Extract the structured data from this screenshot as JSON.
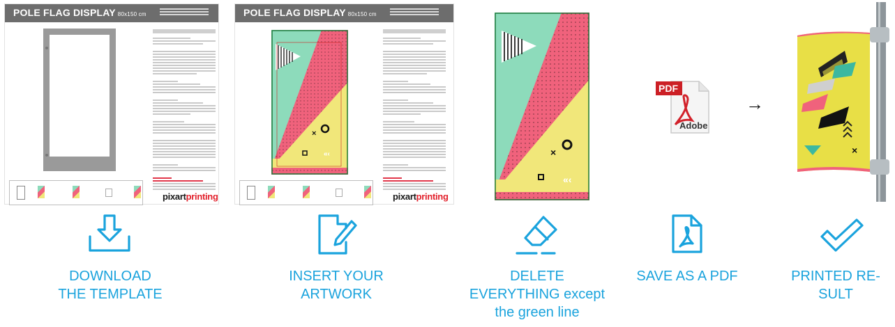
{
  "template_sheet": {
    "title": "POLE FLAG DISPLAY",
    "size": "80x150 cm",
    "brand_part1": "pixart",
    "brand_part2": "printing"
  },
  "pdf_icon": {
    "badge": "PDF",
    "vendor": "Adobe"
  },
  "arrow": "→",
  "steps": [
    {
      "icon": "download-tray-icon",
      "line1": "DOWNLOAD",
      "line2": "THE TEMPLATE"
    },
    {
      "icon": "edit-document-icon",
      "line1": "INSERT YOUR",
      "line2": "ARTWORK"
    },
    {
      "icon": "eraser-icon",
      "line1": "DELETE",
      "line2": "EVERYTHING except",
      "line3": "the green line"
    },
    {
      "icon": "pdf-document-icon",
      "line1": "SAVE AS A PDF"
    },
    {
      "icon": "checkmark-icon",
      "line1": "PRINTED RE-",
      "line2": "SULT"
    }
  ],
  "colors": {
    "accent": "#1aa3dd",
    "pink": "#f0627c",
    "mint": "#8ddbbb",
    "yellow": "#f1e77a",
    "template_grey": "#9a9a9a",
    "brand_red": "#e2222d",
    "green_line": "#1f7a3d"
  }
}
